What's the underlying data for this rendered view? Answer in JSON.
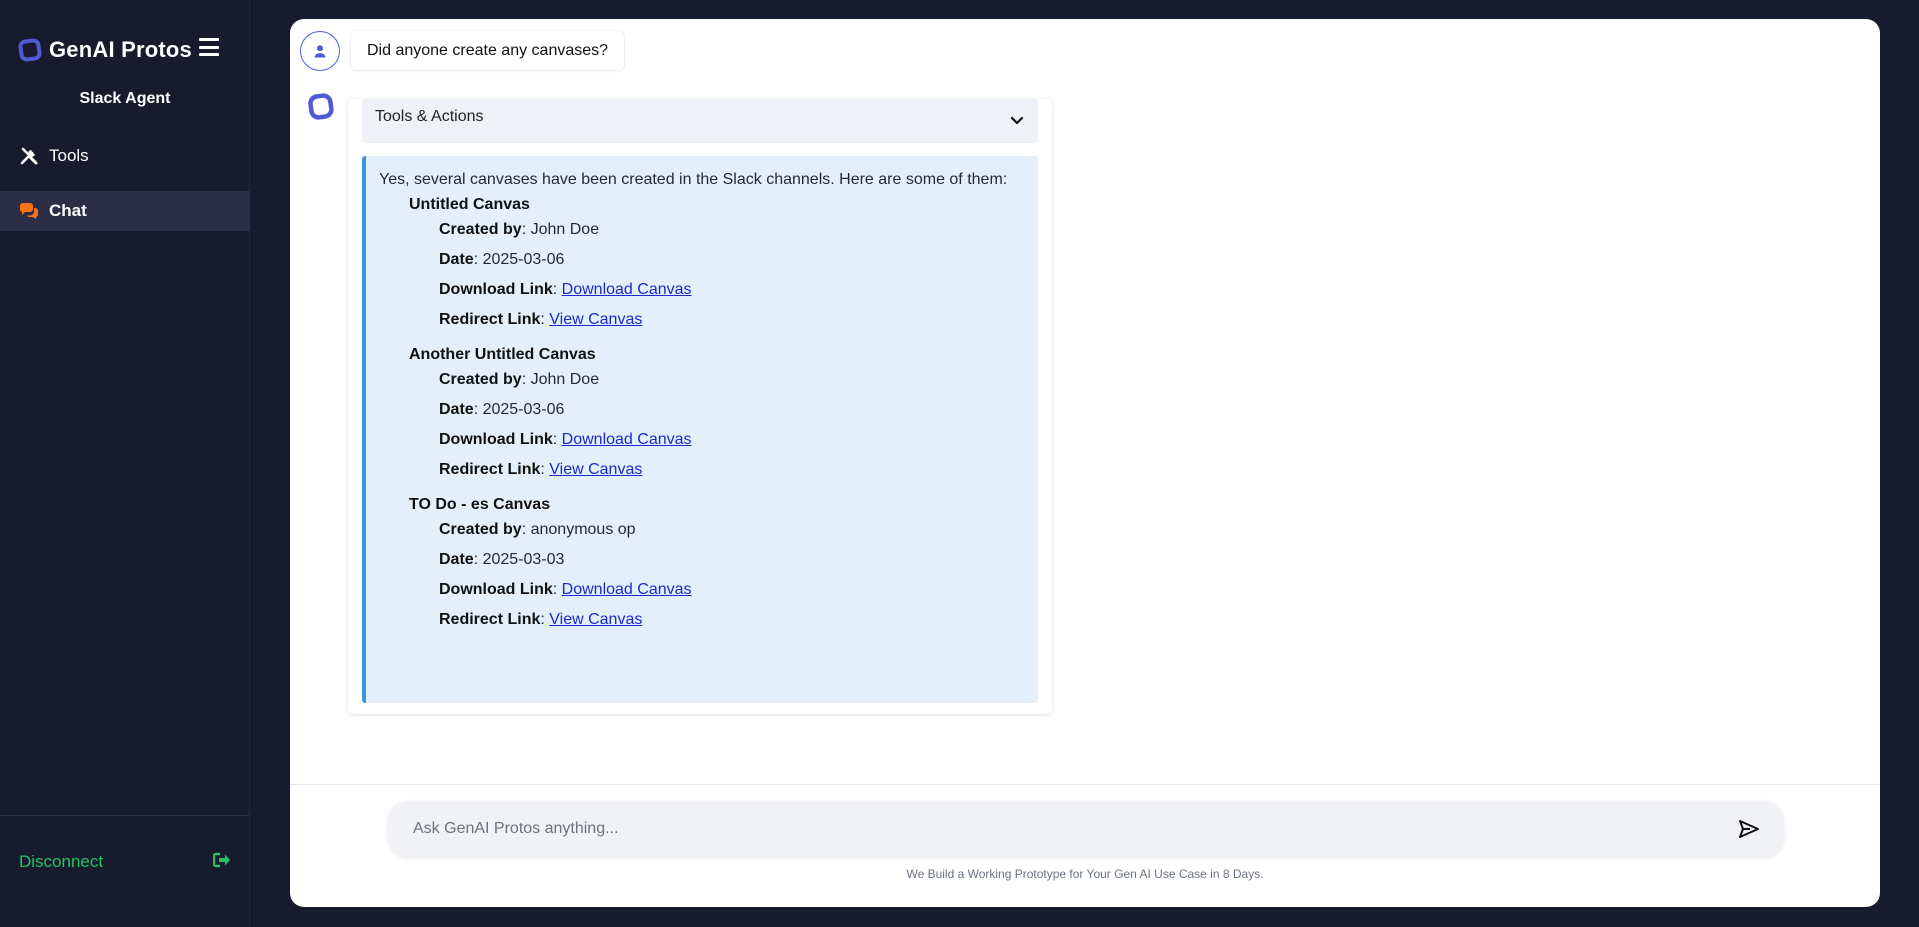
{
  "sidebar": {
    "brand": "GenAI Protos",
    "agent_title": "Slack Agent",
    "nav": [
      {
        "label": "Tools",
        "icon": "tools-icon"
      },
      {
        "label": "Chat",
        "icon": "chat-icon"
      }
    ],
    "disconnect_label": "Disconnect"
  },
  "chat": {
    "user_message": "Did anyone create any canvases?",
    "tools_actions_label": "Tools & Actions",
    "answer_intro": "Yes, several canvases have been created in the Slack channels. Here are some of them:",
    "field_labels": {
      "created_by": "Created by",
      "date": "Date",
      "download": "Download Link",
      "redirect": "Redirect Link"
    },
    "canvases": [
      {
        "title": "Untitled Canvas",
        "created_by": "John Doe",
        "date": "2025-03-06",
        "download_text": "Download Canvas",
        "redirect_text": "View Canvas"
      },
      {
        "title": "Another Untitled Canvas",
        "created_by": "John Doe",
        "date": "2025-03-06",
        "download_text": "Download Canvas",
        "redirect_text": "View Canvas"
      },
      {
        "title": "TO Do - es Canvas",
        "created_by": "anonymous op",
        "date": "2025-03-03",
        "download_text": "Download Canvas",
        "redirect_text": "View Canvas"
      }
    ]
  },
  "input": {
    "placeholder": "Ask GenAI Protos anything...",
    "footer_note": "We Build a Working Prototype for Your Gen AI Use Case in 8 Days."
  },
  "colors": {
    "sidebar_bg": "#181a2e",
    "accent": "#4f5bd5",
    "chat_icon": "#f97316",
    "disconnect": "#22c55e",
    "answer_bg": "#e3f0fc",
    "answer_border": "#3b94dc",
    "link": "#1d28c9"
  }
}
